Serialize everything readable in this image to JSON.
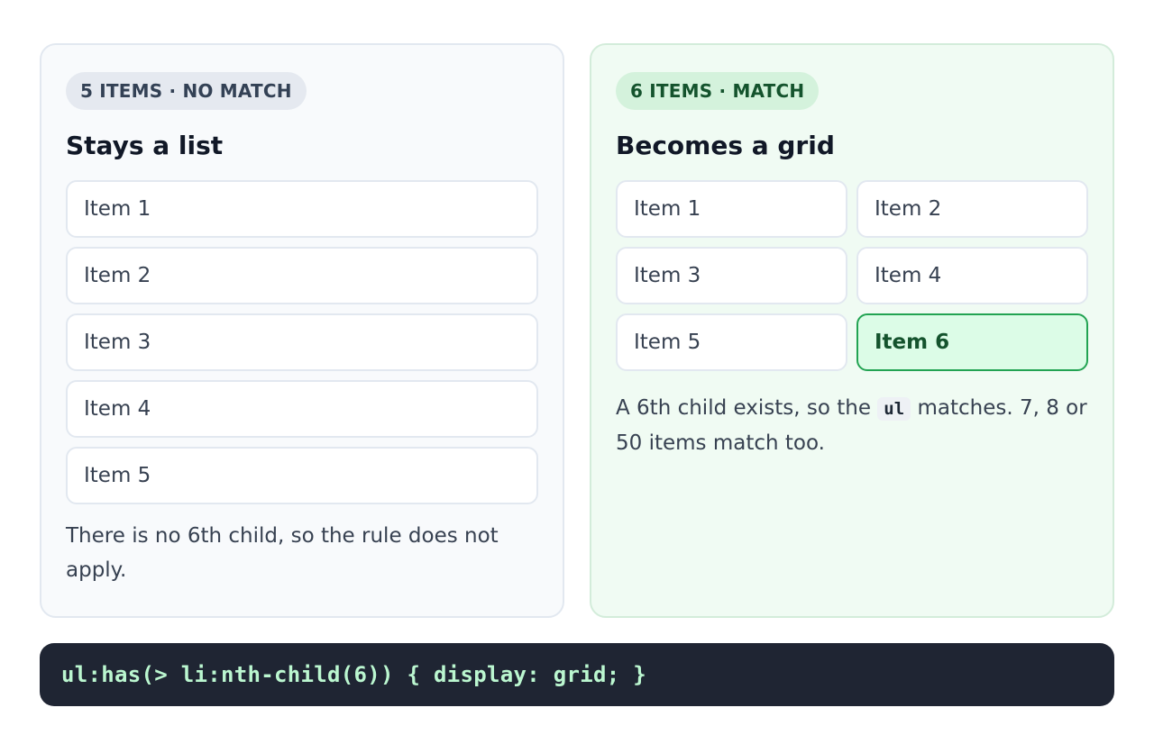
{
  "left_panel": {
    "badge": "5 ITEMS · NO MATCH",
    "heading": "Stays a list",
    "items": [
      "Item 1",
      "Item 2",
      "Item 3",
      "Item 4",
      "Item 5"
    ],
    "note": "There is no 6th child, so the rule does not apply."
  },
  "right_panel": {
    "badge": "6 ITEMS · MATCH",
    "heading": "Becomes a grid",
    "items": [
      "Item 1",
      "Item 2",
      "Item 3",
      "Item 4",
      "Item 5",
      "Item 6"
    ],
    "highlighted_item": "Item 6",
    "note_before": "A 6th child exists, so the ",
    "note_code": "ul",
    "note_after": " matches. 7, 8 or 50 items match too."
  },
  "code": {
    "snippet": "ul:has(> li:nth-child(6)) { display: grid; }"
  },
  "colors": {
    "match_accent": "#22a352",
    "match_background": "#f0fbf3",
    "code_background": "#1f2533",
    "code_text": "#bbf7d0"
  }
}
